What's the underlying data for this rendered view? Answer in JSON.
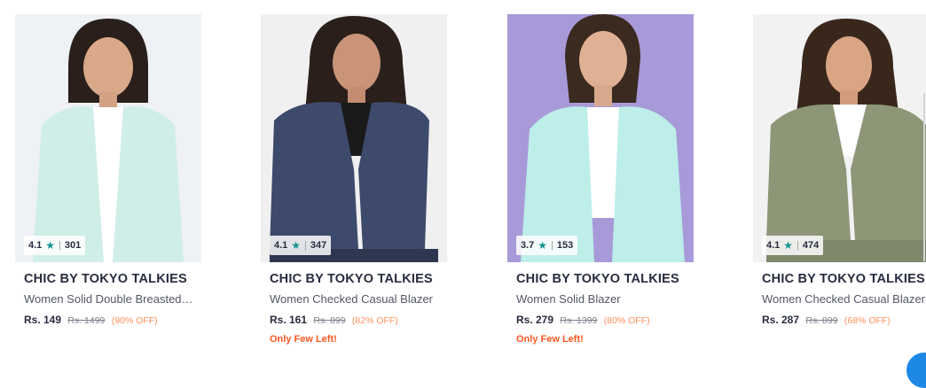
{
  "products": [
    {
      "brand": "CHIC BY TOKYO TALKIES",
      "name": "Women Solid Double Breasted…",
      "rating": "4.1",
      "rating_count": "301",
      "price": "Rs. 149",
      "mrp": "Rs. 1499",
      "discount": "(90% OFF)",
      "stock_note": "",
      "bg": "#eef1f5",
      "outfit": "#cfeee7",
      "top": "#ffffff"
    },
    {
      "brand": "CHIC BY TOKYO TALKIES",
      "name": "Women Checked Casual Blazer",
      "rating": "4.1",
      "rating_count": "347",
      "price": "Rs. 161",
      "mrp": "Rs. 899",
      "discount": "(82% OFF)",
      "stock_note": "Only Few Left!",
      "bg": "#f0f0f0",
      "outfit": "#3d4a6b",
      "top": "#1a1a1a"
    },
    {
      "brand": "CHIC BY TOKYO TALKIES",
      "name": "Women Solid Blazer",
      "rating": "3.7",
      "rating_count": "153",
      "price": "Rs. 279",
      "mrp": "Rs. 1399",
      "discount": "(80% OFF)",
      "stock_note": "Only Few Left!",
      "bg": "#a89ad9",
      "outfit": "#bdeeea",
      "top": "#ffffff"
    },
    {
      "brand": "CHIC BY TOKYO TALKIES",
      "name": "Women Checked Casual Blazer",
      "rating": "4.1",
      "rating_count": "474",
      "price": "Rs. 287",
      "mrp": "Rs. 899",
      "discount": "(68% OFF)",
      "stock_note": "",
      "bg": "#f2f2f2",
      "outfit": "#8d9677",
      "top": "#ffffff"
    }
  ],
  "icons": {
    "rating_star": "star-icon"
  },
  "colors": {
    "rating_star": "#14958f",
    "discount": "#ff905a",
    "stock_note": "#ff5722"
  }
}
